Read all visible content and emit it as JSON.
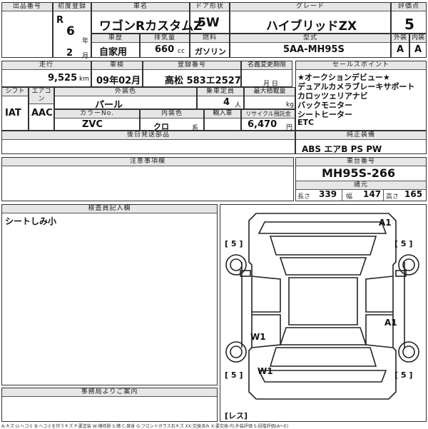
{
  "headers": {
    "lot_no": "出品番号",
    "first_reg": "初度登録",
    "car_name": "車名",
    "door": "ドア形状",
    "grade": "グレード",
    "score": "評価点",
    "history": "車歴",
    "displacement": "排気量",
    "fuel": "燃料",
    "model_code": "型式",
    "exterior": "外装",
    "interior": "内装",
    "mileage": "走行",
    "inspection": "車検",
    "reg_no": "登録番号",
    "transfer_deadline": "名義変更期限",
    "sales_point": "セールスポイント",
    "shift": "シフト",
    "ac": "エアコン",
    "ext_color": "外装色",
    "capacity": "乗車定員",
    "max_load": "最大積載量",
    "color_no": "カラーNo.",
    "int_color": "内装色",
    "import": "輸入車",
    "recycle": "リサイクル預託金",
    "later_parts": "後日発送部品",
    "genuine": "純正装備",
    "notes": "注意事項欄",
    "chassis": "車台番号",
    "dimensions": "諸元",
    "inspector": "検査員記入欄",
    "office": "事務局よりご案内"
  },
  "era": "R",
  "year": "6",
  "year_unit": "年",
  "month": "2",
  "month_unit": "月",
  "car_name": "ワゴンRカスタムZ",
  "door": "5W",
  "grade": "ハイブリッドZX",
  "score": "5",
  "history": "自家用",
  "displacement": "660",
  "displacement_unit": "cc",
  "fuel": "ガソリン",
  "model_code": "5AA-MH95S",
  "exterior_score": "A",
  "interior_score": "A",
  "mileage": "9,525",
  "mileage_unit": "km",
  "inspection": "09年02月",
  "reg_no": "高松 583エ2527",
  "transfer_deadline_unit": "月 日",
  "sales_points": [
    "★オークションデビュー★",
    "デュアルカメラブレーキサポート",
    "カロッツェリアナビ",
    "バックモニター",
    "シートヒーター",
    "ETC"
  ],
  "shift": "IAT",
  "ac": "AAC",
  "ext_color": "パール",
  "capacity": "4",
  "capacity_unit": "人",
  "max_load_unit": "kg",
  "color_no": "ZVC",
  "int_color": "クロ",
  "int_color_unit": "系",
  "recycle": "6,470",
  "recycle_unit": "円",
  "genuine": "ABS エアB PS PW",
  "chassis": "MH95S-266",
  "dim_len_label": "長さ",
  "dim_len": "339",
  "dim_wid_label": "幅",
  "dim_wid": "147",
  "dim_hei_label": "高さ",
  "dim_hei": "165",
  "inspector_note": "シートしみ小",
  "diagram_marks": {
    "fl_tire": "[ 5 ]",
    "fr_tire": "[ 5 ]",
    "rl_tire": "[ 5 ]",
    "rr_tire": "[ 5 ]",
    "a1_top": "A1",
    "a1_right": "A1",
    "w1_left": "W1",
    "w1_bottom": "W1",
    "spare": "[レス]"
  },
  "legend": "A:キズ U:ヘコミ B:ヘコミを伴うキズ P:要塗装 W:補修跡 S:錆 C:腐食 G:フロントガラス石キズ XX:交換済み X:要交換 内:外装評価 S:段階評価(A〜E)"
}
